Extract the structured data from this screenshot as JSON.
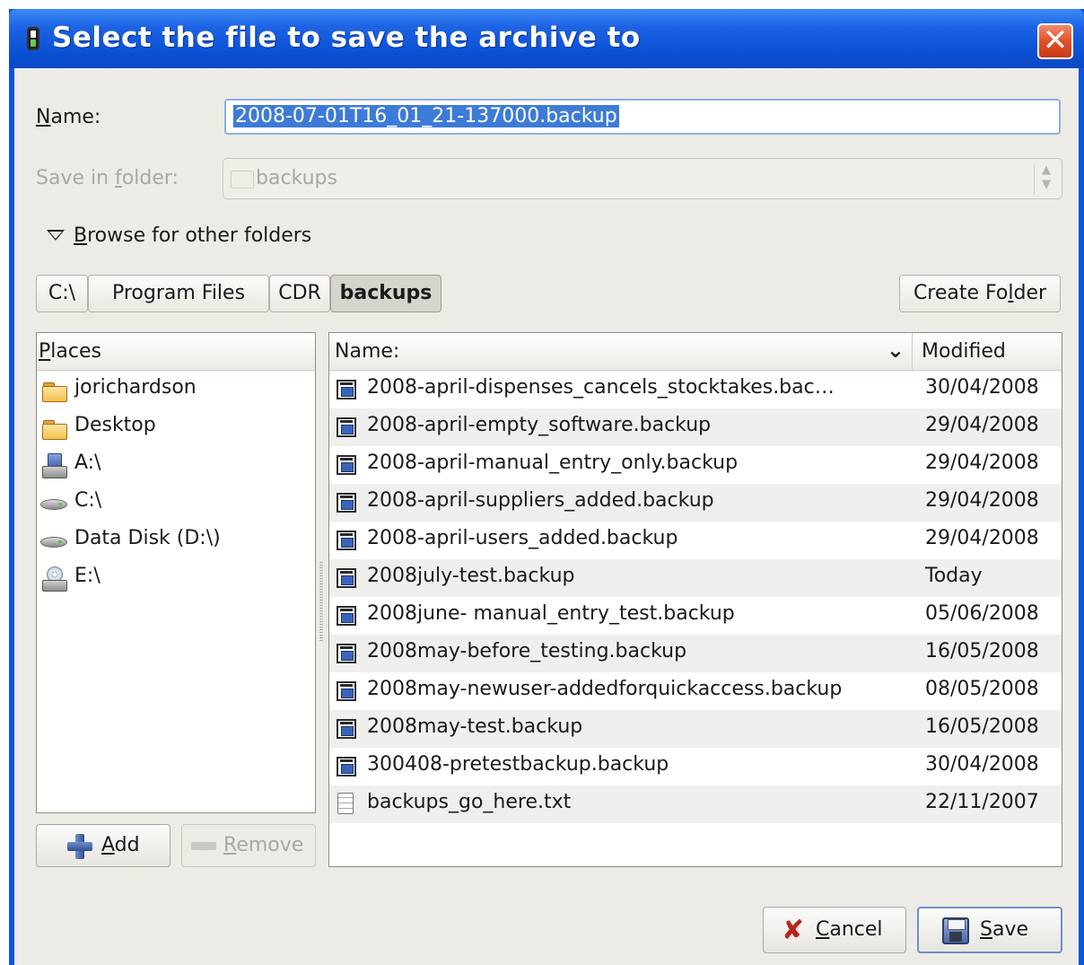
{
  "window": {
    "title": "Select the file to save the archive to",
    "close_glyph": "✕",
    "colors": {
      "titlebar": "#0b52d6",
      "close": "#e0502c",
      "selection": "#3d7bd8"
    }
  },
  "name_field": {
    "label_mnemonic": "N",
    "label_rest": "ame:",
    "value": "2008-07-01T16_01_21-137000.backup"
  },
  "save_in_folder": {
    "label_pre": "Save in ",
    "label_mnemonic": "f",
    "label_post": "older:",
    "value": "backups",
    "enabled": false
  },
  "browse_expander": {
    "label_mnemonic": "B",
    "label_rest": "rowse for other folders",
    "expanded": true
  },
  "path_bar": {
    "buttons": [
      "C:\\",
      "Program Files",
      "CDR",
      "backups"
    ],
    "active_index": 3
  },
  "create_folder": {
    "label_pre": "Create Fo",
    "label_mnemonic": "l",
    "label_post": "der"
  },
  "places": {
    "header_mnemonic": "P",
    "header_rest": "laces",
    "items": [
      {
        "label": "jorichardson",
        "icon": "folder-icon"
      },
      {
        "label": "Desktop",
        "icon": "folder-icon"
      },
      {
        "label": "A:\\",
        "icon": "floppy-drive-icon"
      },
      {
        "label": "C:\\",
        "icon": "hard-drive-icon"
      },
      {
        "label": "Data Disk (D:\\)",
        "icon": "hard-drive-icon"
      },
      {
        "label": "E:\\",
        "icon": "cd-drive-icon"
      }
    ],
    "add_mnemonic": "A",
    "add_rest": "dd",
    "remove_mnemonic": "R",
    "remove_rest": "emove",
    "remove_enabled": false
  },
  "files": {
    "col_name": "Name:",
    "col_modified": "Modified",
    "sort_glyph": "⌄",
    "rows": [
      {
        "name": "2008-april-dispenses_cancels_stocktakes.bac…",
        "modified": "30/04/2008",
        "icon": "backup-file-icon"
      },
      {
        "name": "2008-april-empty_software.backup",
        "modified": "29/04/2008",
        "icon": "backup-file-icon"
      },
      {
        "name": "2008-april-manual_entry_only.backup",
        "modified": "29/04/2008",
        "icon": "backup-file-icon"
      },
      {
        "name": "2008-april-suppliers_added.backup",
        "modified": "29/04/2008",
        "icon": "backup-file-icon"
      },
      {
        "name": "2008-april-users_added.backup",
        "modified": "29/04/2008",
        "icon": "backup-file-icon"
      },
      {
        "name": "2008july-test.backup",
        "modified": "Today",
        "icon": "backup-file-icon"
      },
      {
        "name": "2008june- manual_entry_test.backup",
        "modified": "05/06/2008",
        "icon": "backup-file-icon"
      },
      {
        "name": "2008may-before_testing.backup",
        "modified": "16/05/2008",
        "icon": "backup-file-icon"
      },
      {
        "name": "2008may-newuser-addedforquickaccess.backup",
        "modified": "08/05/2008",
        "icon": "backup-file-icon"
      },
      {
        "name": "2008may-test.backup",
        "modified": "16/05/2008",
        "icon": "backup-file-icon"
      },
      {
        "name": "300408-pretestbackup.backup",
        "modified": "30/04/2008",
        "icon": "backup-file-icon"
      },
      {
        "name": "backups_go_here.txt",
        "modified": "22/11/2007",
        "icon": "text-file-icon"
      }
    ]
  },
  "actions": {
    "cancel_mnemonic": "C",
    "cancel_rest": "ancel",
    "save_mnemonic": "S",
    "save_rest": "ave"
  }
}
